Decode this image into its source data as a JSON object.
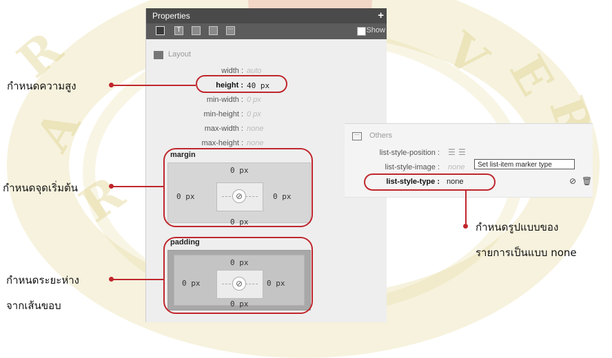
{
  "colors": {
    "highlight": "#c0262c",
    "panel_header": "#4a4a4a",
    "panel_bg": "#eeeeee"
  },
  "panel": {
    "title": "Properties",
    "add_icon": "plus-icon",
    "toolbar": {
      "icons": [
        "layout-icon",
        "text-icon",
        "background-icon",
        "border-icon",
        "others-icon"
      ],
      "show_label": "Show"
    },
    "layout": {
      "title": "Layout",
      "icon": "layout-icon",
      "props": [
        {
          "name": "width :",
          "value": "auto"
        },
        {
          "name": "height :",
          "value": "40 px"
        },
        {
          "name": "min-width :",
          "value": "0 px"
        },
        {
          "name": "min-height :",
          "value": "0 px"
        },
        {
          "name": "max-width :",
          "value": "none"
        },
        {
          "name": "max-height :",
          "value": "none"
        }
      ]
    },
    "margin": {
      "title": "margin",
      "top": "0 px",
      "left": "0 px",
      "right": "0 px",
      "bottom": "0 px",
      "link_icon": "link-icon"
    },
    "padding": {
      "title": "padding",
      "top": "0 px",
      "left": "0 px",
      "right": "0 px",
      "bottom": "0 px",
      "link_icon": "link-icon"
    }
  },
  "others": {
    "title": "Others",
    "icon": "others-icon",
    "props": [
      {
        "name": "list-style-position :",
        "value": ""
      },
      {
        "name": "list-style-image :",
        "value": "none"
      },
      {
        "name": "list-style-type :",
        "value": "none"
      }
    ],
    "tooltip": "Set list-item marker type",
    "action_icons": [
      "clear-icon",
      "delete-icon"
    ]
  },
  "annotations": {
    "height": "กำหนดความสูง",
    "margin": "กำหนดจุดเริ่มต้น",
    "padding_line1": "กำหนดระยะห่าง",
    "padding_line2": "จากเส้นขอบ",
    "list_type_line1": "กำหนดรูปแบบของ",
    "list_type_line2": "รายการเป็นแบบ none"
  }
}
